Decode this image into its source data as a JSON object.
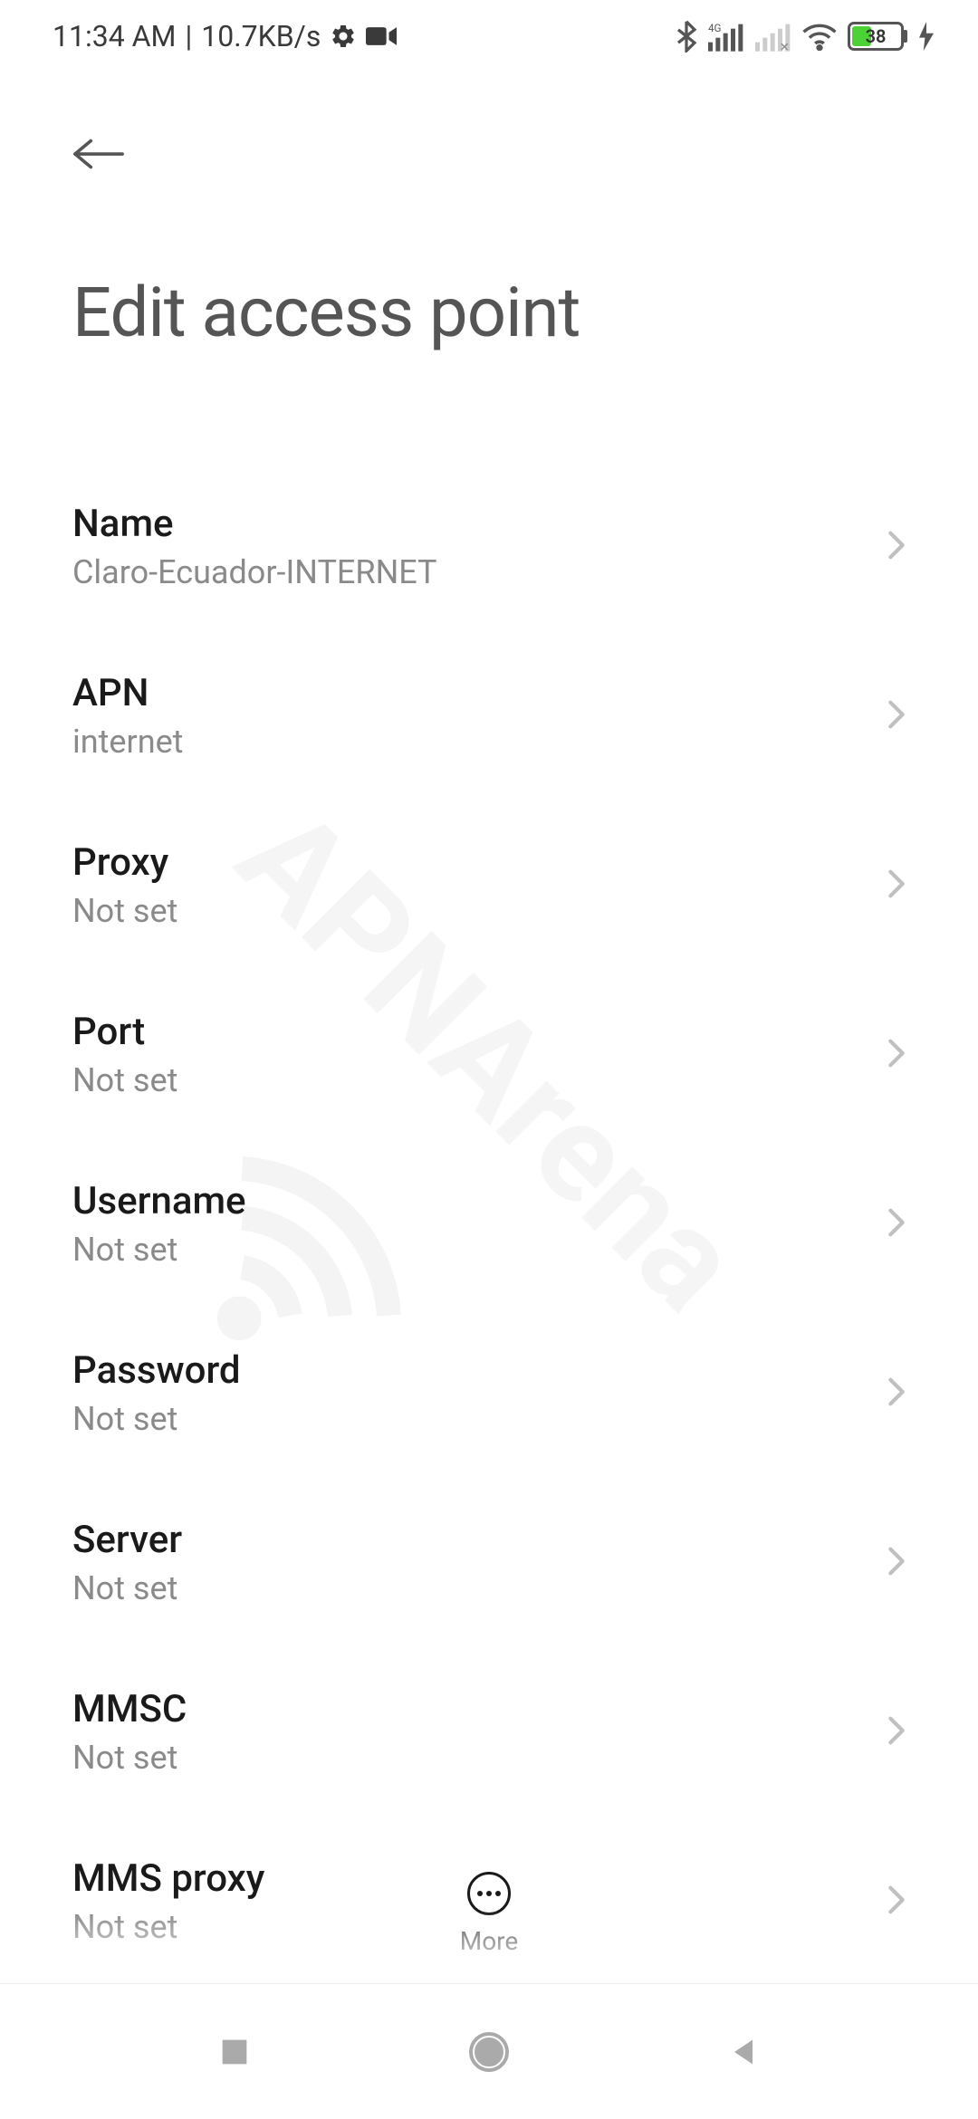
{
  "status_bar": {
    "time": "11:34 AM",
    "data_rate": "10.7KB/s",
    "battery_pct": "38"
  },
  "header": {
    "title": "Edit access point"
  },
  "settings": [
    {
      "label": "Name",
      "value": "Claro-Ecuador-INTERNET"
    },
    {
      "label": "APN",
      "value": "internet"
    },
    {
      "label": "Proxy",
      "value": "Not set"
    },
    {
      "label": "Port",
      "value": "Not set"
    },
    {
      "label": "Username",
      "value": "Not set"
    },
    {
      "label": "Password",
      "value": "Not set"
    },
    {
      "label": "Server",
      "value": "Not set"
    },
    {
      "label": "MMSC",
      "value": "Not set"
    },
    {
      "label": "MMS proxy",
      "value": "Not set"
    }
  ],
  "bottom_action": {
    "label": "More"
  },
  "watermark": "APNArena"
}
